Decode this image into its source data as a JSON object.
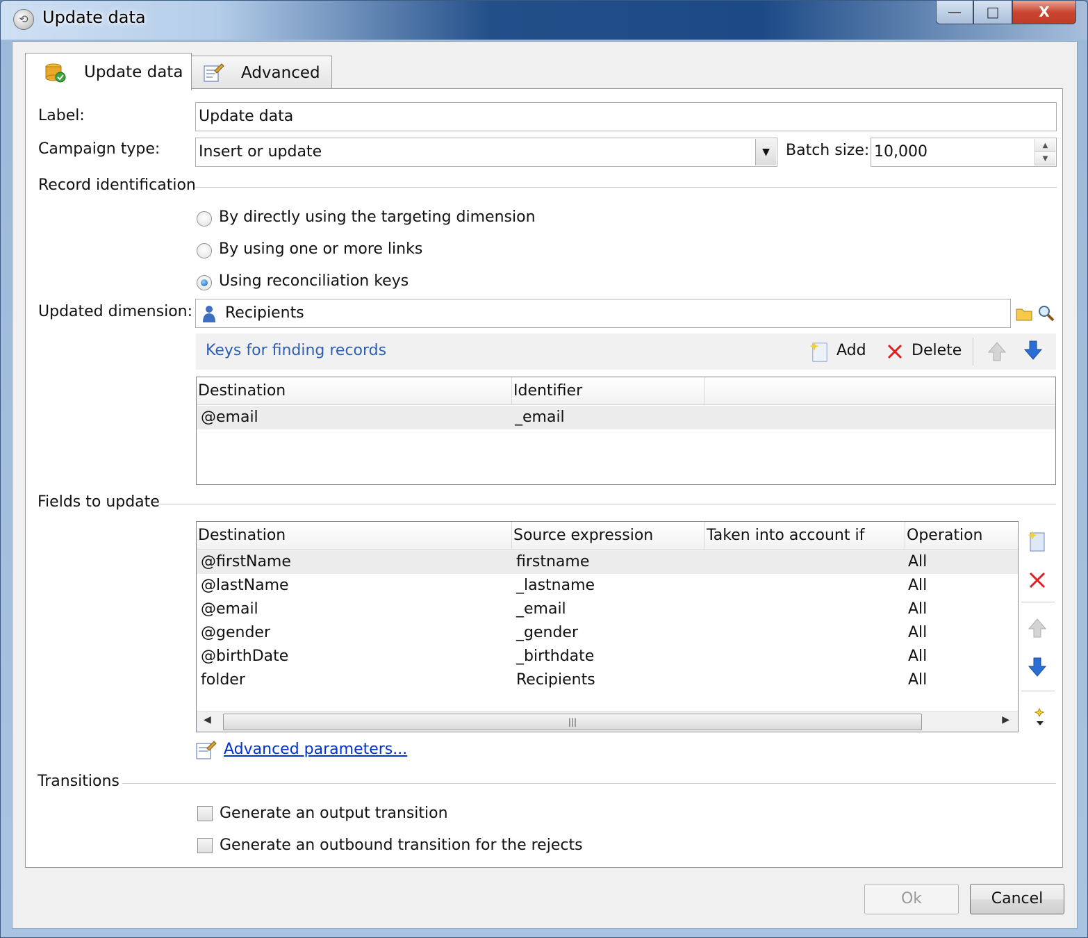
{
  "window": {
    "title": "Update data",
    "controls": {
      "minimize": "—",
      "maximize": "□",
      "close": "X"
    }
  },
  "tabs": [
    {
      "label": "Update data",
      "icon": "database-update-icon",
      "active": true
    },
    {
      "label": "Advanced",
      "icon": "advanced-settings-icon",
      "active": false
    }
  ],
  "form": {
    "label_caption": "Label:",
    "label_value": "Update data",
    "campaign_type_caption": "Campaign type:",
    "campaign_type_value": "Insert or update",
    "batch_size_caption": "Batch size:",
    "batch_size_value": "10,000"
  },
  "record_identification": {
    "section_title": "Record identification",
    "options": [
      {
        "label": "By directly using the targeting dimension",
        "selected": false
      },
      {
        "label": "By using one or more links",
        "selected": false
      },
      {
        "label": "Using reconciliation keys",
        "selected": true
      }
    ]
  },
  "updated_dimension": {
    "caption": "Updated dimension:",
    "value": "Recipients"
  },
  "keys": {
    "title": "Keys for finding records",
    "add_label": "Add",
    "delete_label": "Delete",
    "columns": [
      "Destination",
      "Identifier"
    ],
    "rows": [
      {
        "destination": "@email",
        "identifier": "_email"
      }
    ]
  },
  "fields": {
    "section_title": "Fields to update",
    "columns": [
      "Destination",
      "Source expression",
      "Taken into account if",
      "Operation"
    ],
    "rows": [
      {
        "destination": "@firstName",
        "source": "firstname",
        "condition": "",
        "operation": "All"
      },
      {
        "destination": "@lastName",
        "source": "_lastname",
        "condition": "",
        "operation": "All"
      },
      {
        "destination": "@email",
        "source": "_email",
        "condition": "",
        "operation": "All"
      },
      {
        "destination": "@gender",
        "source": "_gender",
        "condition": "",
        "operation": "All"
      },
      {
        "destination": "@birthDate",
        "source": "_birthdate",
        "condition": "",
        "operation": "All"
      },
      {
        "destination": "folder",
        "source": "Recipients",
        "condition": "",
        "operation": "All"
      }
    ],
    "advanced_link": "Advanced parameters..."
  },
  "transitions": {
    "section_title": "Transitions",
    "options": [
      {
        "label": "Generate an output transition",
        "checked": false
      },
      {
        "label": "Generate an outbound transition for the rejects",
        "checked": false
      }
    ]
  },
  "footer": {
    "ok_label": "Ok",
    "cancel_label": "Cancel"
  },
  "colors": {
    "link": "#0033cc",
    "keys_title": "#2f5fb3",
    "delete_red": "#e02020",
    "arrow_blue": "#2a6fd3"
  }
}
